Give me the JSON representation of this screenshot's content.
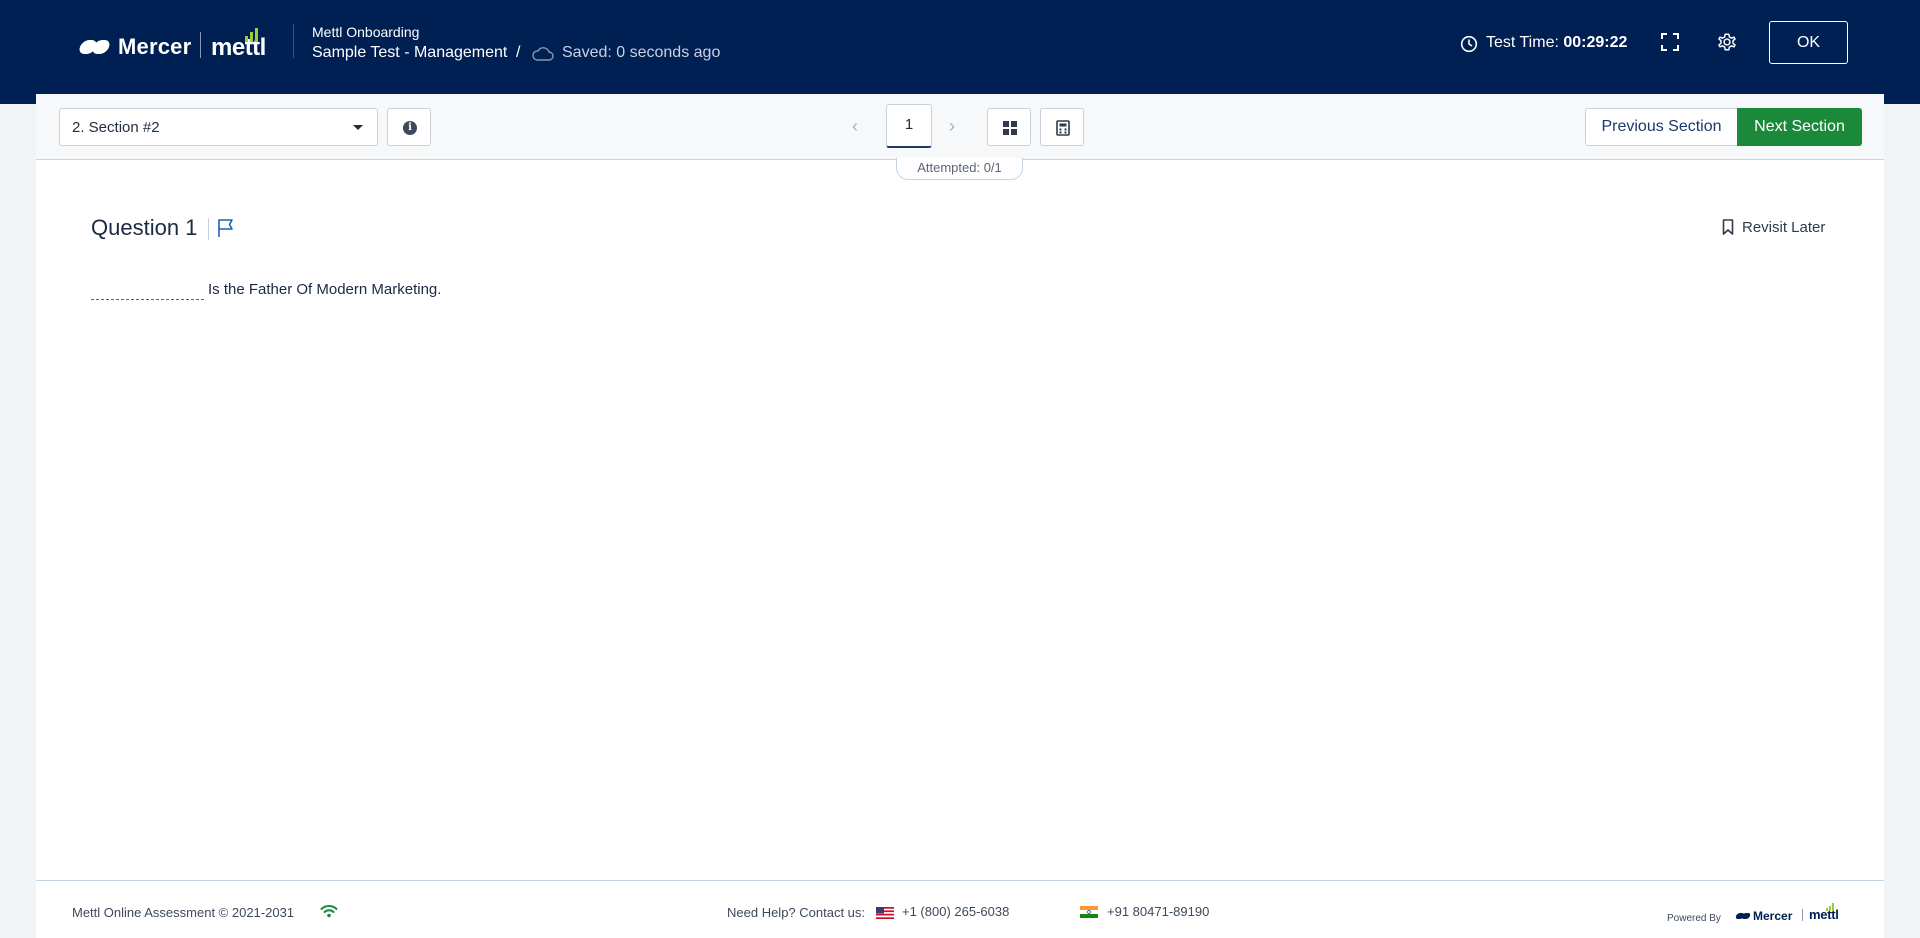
{
  "header": {
    "brand_mercer": "Mercer",
    "brand_mettl": "mettl",
    "org_name": "Mettl Onboarding",
    "test_name": "Sample Test - Management",
    "separator": "/",
    "saved_status": "Saved: 0 seconds ago",
    "timer_label": "Test Time:",
    "timer_value": "00:29:22",
    "ok_label": "OK"
  },
  "toolbar": {
    "section_selected": "2. Section #2",
    "current_page": "1",
    "prev_section_label": "Previous Section",
    "next_section_label": "Next Section",
    "attempted": "Attempted: 0/1"
  },
  "question": {
    "title": "Question 1",
    "revisit_label": "Revisit Later",
    "text": "Is the Father Of Modern Marketing."
  },
  "footer": {
    "copyright": "Mettl Online Assessment © 2021-2031",
    "help_label": "Need Help? Contact us:",
    "phone_us": "+1 (800) 265-6038",
    "phone_in": "+91 80471-89190",
    "powered_by": "Powered By",
    "brand_mercer": "Mercer",
    "brand_mettl": "mettl"
  },
  "colors": {
    "header_bg": "#001f52",
    "next_section_bg": "#1a8a3a",
    "accent_green": "#9ccc3f",
    "wifi_green": "#1a8a3a"
  },
  "icons": [
    "cloud-icon",
    "clock-icon",
    "fullscreen-icon",
    "gear-icon",
    "info-icon",
    "chevron-left-icon",
    "chevron-right-icon",
    "grid-icon",
    "calculator-icon",
    "flag-icon",
    "bookmark-icon",
    "wifi-icon",
    "us-flag-icon",
    "india-flag-icon"
  ]
}
